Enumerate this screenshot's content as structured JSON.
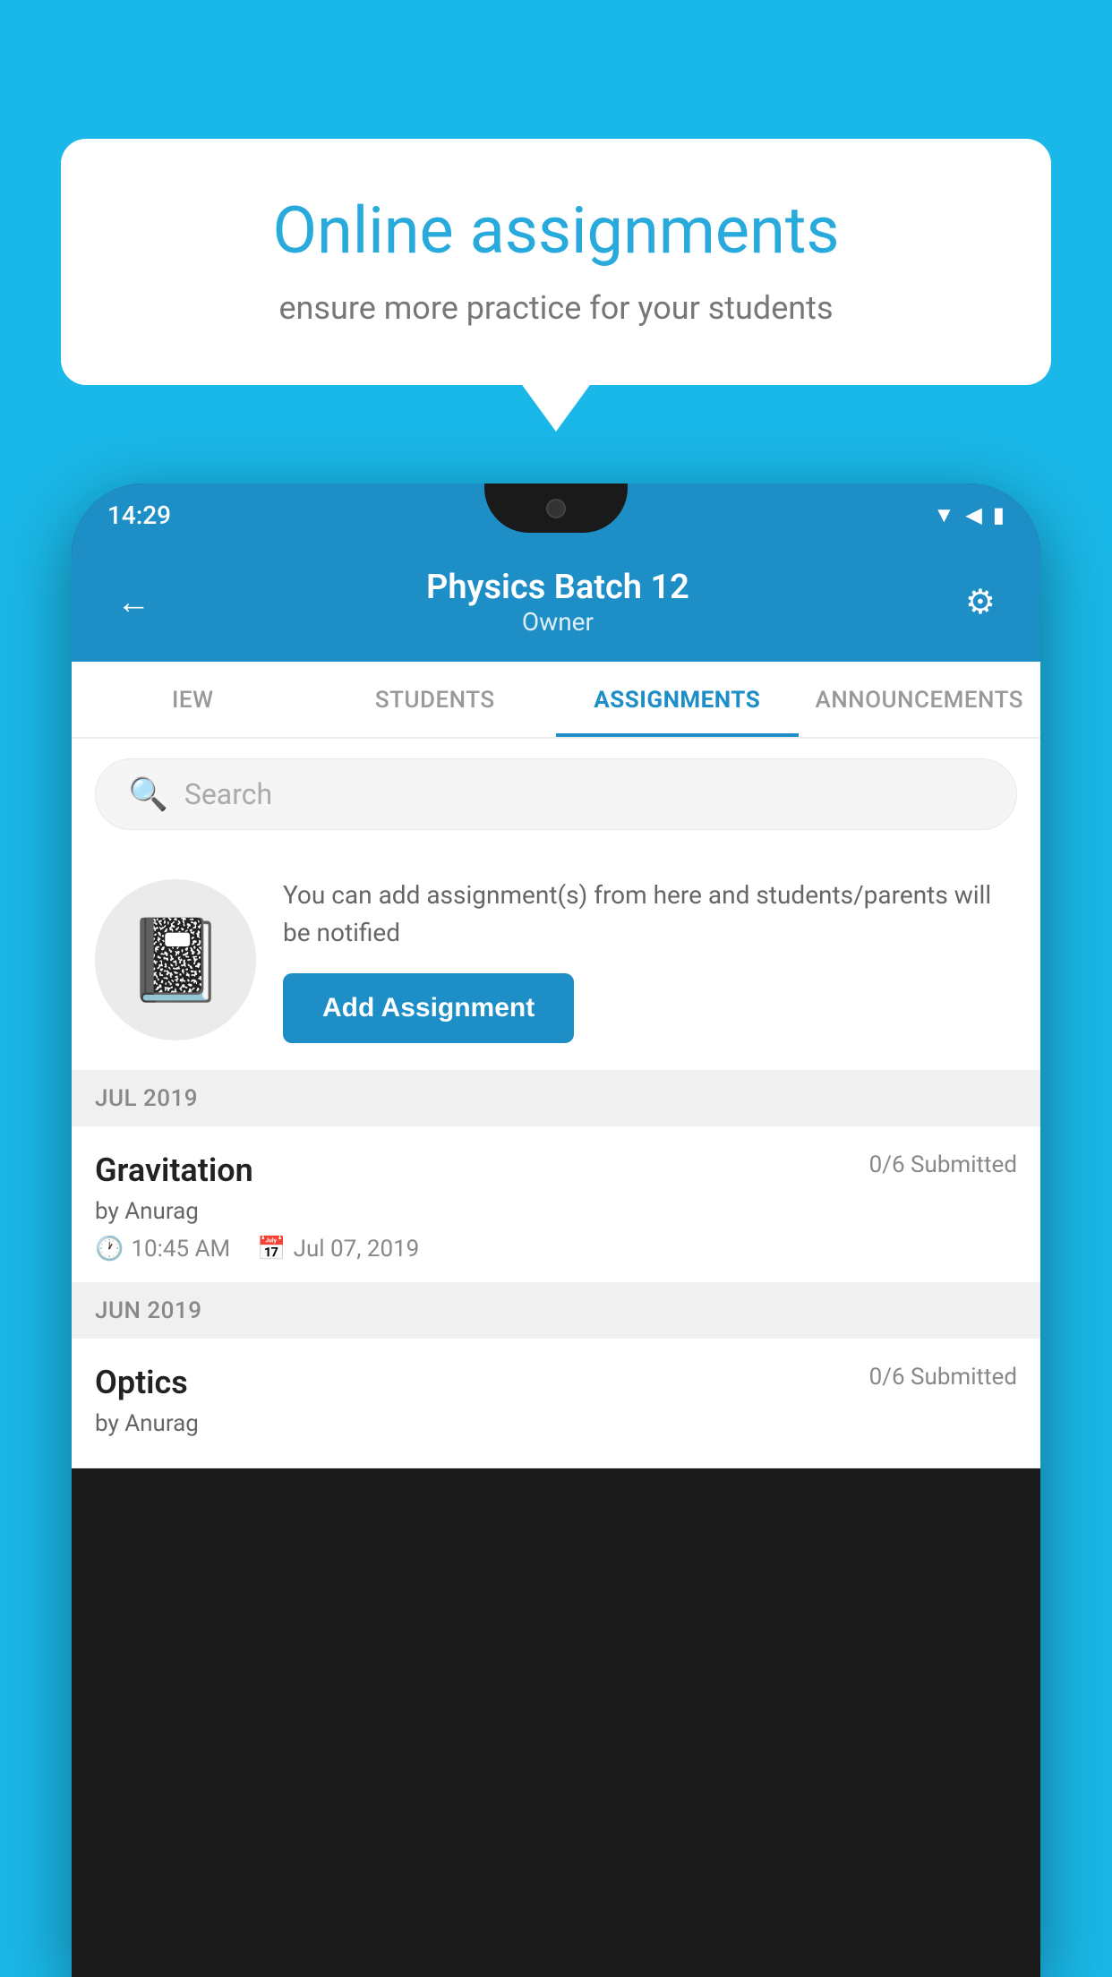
{
  "background_color": "#1ab8e8",
  "speech_bubble": {
    "title": "Online assignments",
    "subtitle": "ensure more practice for your students"
  },
  "phone": {
    "status_bar": {
      "time": "14:29",
      "icons": [
        "wifi",
        "signal",
        "battery"
      ]
    },
    "header": {
      "title": "Physics Batch 12",
      "subtitle": "Owner",
      "back_label": "←",
      "settings_label": "⚙"
    },
    "tabs": [
      {
        "label": "IEW",
        "active": false
      },
      {
        "label": "STUDENTS",
        "active": false
      },
      {
        "label": "ASSIGNMENTS",
        "active": true
      },
      {
        "label": "ANNOUNCEMENTS",
        "active": false
      }
    ],
    "search": {
      "placeholder": "Search"
    },
    "add_assignment_section": {
      "description": "You can add assignment(s) from here and students/parents will be notified",
      "button_label": "Add Assignment"
    },
    "month_sections": [
      {
        "month_label": "JUL 2019",
        "assignments": [
          {
            "title": "Gravitation",
            "submitted": "0/6 Submitted",
            "by": "by Anurag",
            "time": "10:45 AM",
            "date": "Jul 07, 2019"
          }
        ]
      },
      {
        "month_label": "JUN 2019",
        "assignments": [
          {
            "title": "Optics",
            "submitted": "0/6 Submitted",
            "by": "by Anurag",
            "time": "",
            "date": ""
          }
        ]
      }
    ]
  }
}
